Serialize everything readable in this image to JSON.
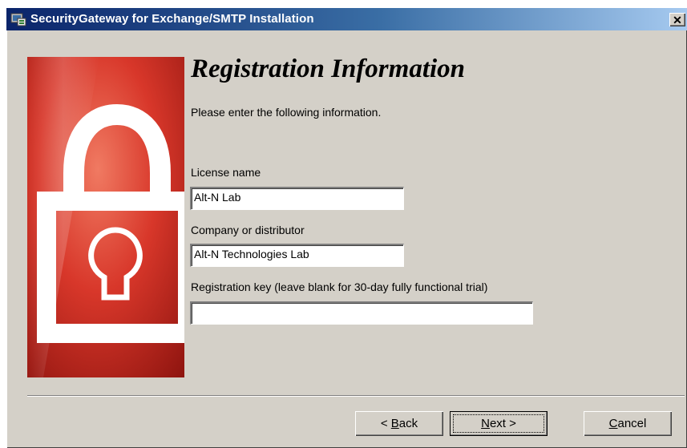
{
  "window": {
    "title": "SecurityGateway for Exchange/SMTP Installation",
    "close_glyph": "✕"
  },
  "page": {
    "heading": "Registration Information",
    "instructions": "Please enter the following information."
  },
  "fields": {
    "license_name": {
      "label": "License name",
      "value": "Alt-N Lab"
    },
    "company": {
      "label": "Company or distributor",
      "value": "Alt-N Technologies Lab"
    },
    "registration_key": {
      "label": "Registration key (leave blank for 30-day fully functional trial)",
      "value": ""
    }
  },
  "buttons": {
    "back": {
      "mnemonic": "B",
      "rest": "ack",
      "prefix": "< "
    },
    "next": {
      "mnemonic": "N",
      "rest": "ext >"
    },
    "cancel": {
      "mnemonic": "C",
      "rest": "ancel"
    }
  },
  "icons": {
    "title": "installer-icon",
    "side_image": "padlock-icon"
  },
  "colors": {
    "titlebar_start": "#0a246a",
    "titlebar_end": "#a6caf0",
    "dialog_face": "#d4d0c8",
    "banner_red": "#c8261e"
  }
}
